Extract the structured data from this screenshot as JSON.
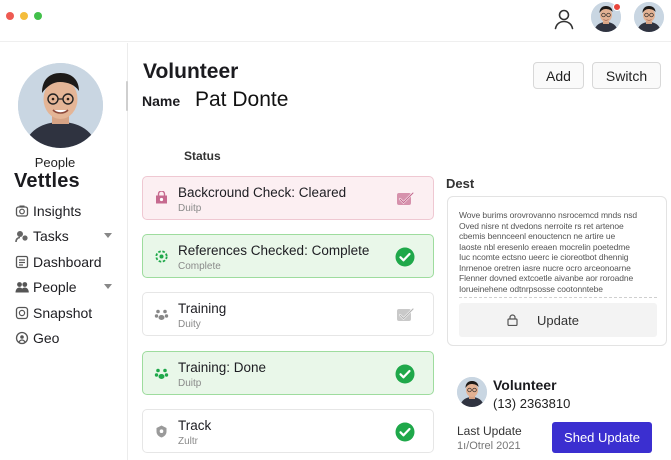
{
  "window": {
    "controls": [
      "close",
      "minimize",
      "maximize"
    ]
  },
  "topbar": {
    "icons": [
      "user-icon",
      "avatar",
      "avatar"
    ]
  },
  "sidebar": {
    "role": "People",
    "brand": "Vettles",
    "items": [
      {
        "label": "Insights",
        "icon": "insights-icon",
        "expandable": false
      },
      {
        "label": "Tasks",
        "icon": "tasks-icon",
        "expandable": true
      },
      {
        "label": "Dashboard",
        "icon": "dashboard-icon",
        "expandable": false
      },
      {
        "label": "People",
        "icon": "people-icon",
        "expandable": true
      },
      {
        "label": "Snapshot",
        "icon": "snapshot-icon",
        "expandable": false
      },
      {
        "label": "Geo",
        "icon": "geo-icon",
        "expandable": false
      }
    ]
  },
  "header": {
    "title": "Volunteer",
    "name_label": "Name",
    "name_value": "Pat Donte",
    "add_label": "Add",
    "switch_label": "Switch"
  },
  "status": {
    "heading": "Status",
    "items": [
      {
        "title": "Backcround Check: Cleared",
        "sub": "Duitp",
        "tone": "pink",
        "check": "faded"
      },
      {
        "title": "References Checked: Complete",
        "sub": "Complete",
        "tone": "green",
        "check": "solid"
      },
      {
        "title": "Training",
        "sub": "Duity",
        "tone": "plain",
        "check": "faded"
      },
      {
        "title": "Training: Done",
        "sub": "Duitp",
        "tone": "green",
        "check": "solid"
      },
      {
        "title": "Track",
        "sub": "Zultr",
        "tone": "plain",
        "check": "solid"
      }
    ]
  },
  "dest": {
    "heading": "Dest",
    "body_lines": [
      "Wove burims orovrovanno nsrocemcd mnds nsd",
      "Oved nisre nt dvedons nerroite rs ret artenoe",
      "cbemis bennceenl enouctencn ne artire ue",
      "Iaoste nbl eresenlo ereaen mocrelin poetedme",
      "Iuc ncomte ectsno ueerc ie cioreotbot dhennig",
      "Inrnenoe oretren iasre nucre ocro arceonoarne",
      "Flenner dovned extcoetle aivanbe aor roroadne",
      "Iorueinehene odtnrpsosse cootonntebe"
    ],
    "update_label": "Update"
  },
  "contact": {
    "title": "Volunteer",
    "phone": "(13) 2363810",
    "last_update_label": "Last Update",
    "last_update_date": "1ı/Otrel 2021",
    "sheet_update_label": "Shed Update"
  },
  "colors": {
    "accent": "#3b2fd0",
    "success": "#1fa84a",
    "pink_bg": "#fceff2",
    "green_bg": "#e9f7e9"
  }
}
